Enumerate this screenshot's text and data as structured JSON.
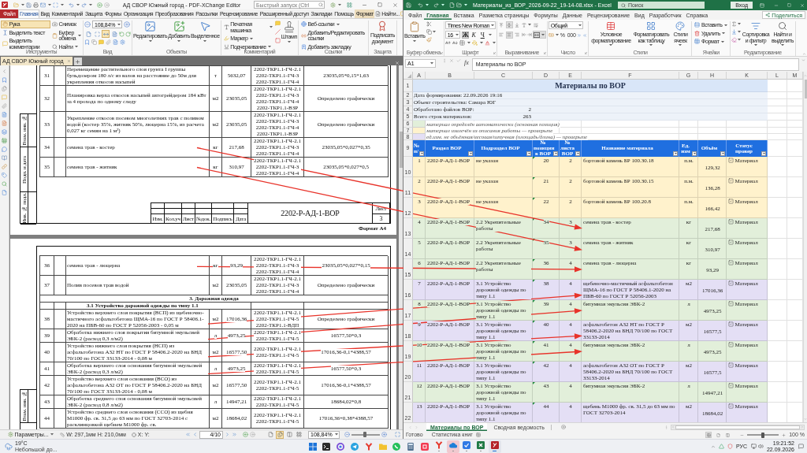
{
  "pdf": {
    "title": "АД СВОР Южный город - PDF-XChange Editor",
    "quick_launch": {
      "placeholder": "Быстрый запуск (Ctrl"
    },
    "menu_tabs": [
      {
        "label": "Файл",
        "kind": "file",
        "selected": false
      },
      {
        "label": "Главная",
        "kind": "tab",
        "selected": true
      },
      {
        "label": "Вид",
        "kind": "tab",
        "selected": false
      },
      {
        "label": "Комментарий",
        "kind": "tab",
        "selected": false
      },
      {
        "label": "Защита",
        "kind": "tab",
        "selected": false
      },
      {
        "label": "Формы",
        "kind": "tab",
        "selected": false
      },
      {
        "label": "Организация",
        "kind": "tab",
        "selected": false
      },
      {
        "label": "Преобразования",
        "kind": "tab",
        "selected": false
      },
      {
        "label": "Рассылки",
        "kind": "tab",
        "selected": false
      },
      {
        "label": "Рецензирование",
        "kind": "tab",
        "selected": false
      },
      {
        "label": "Расширенный доступ",
        "kind": "tab",
        "selected": false
      },
      {
        "label": "Закладки",
        "kind": "tab",
        "selected": false
      },
      {
        "label": "Помощь",
        "kind": "tab",
        "selected": false
      },
      {
        "label": "Формат",
        "kind": "context",
        "selected": false
      }
    ],
    "find": "Найти...",
    "ribbon": [
      {
        "kind": "tools",
        "label": "Инструменты",
        "items": [
          {
            "label": "Рука",
            "selected": true,
            "dropdown": false
          },
          {
            "label": "Выделить текст",
            "selected": false,
            "dropdown": false
          },
          {
            "label": "Выделить комментарии",
            "selected": false,
            "dropdown": false
          },
          {
            "label": "Снимок",
            "selected": false,
            "dropdown": false
          },
          {
            "label": "Буфер обмена",
            "selected": false,
            "dropdown": true
          },
          {
            "label": "Найти",
            "selected": false,
            "dropdown": true
          }
        ]
      },
      {
        "kind": "view",
        "label": "Вид",
        "zoom": "108,84%",
        "fit_modes": [
          {
            "kind": "actual",
            "selected": false
          },
          {
            "kind": "page",
            "selected": false
          },
          {
            "kind": "width",
            "selected": true
          },
          {
            "kind": "visible",
            "selected": false
          }
        ]
      },
      {
        "kind": "objects",
        "label": "Объекты",
        "items": [
          {
            "label": "Редактировать",
            "dropdown": true
          },
          {
            "label": "Добавить",
            "dropdown": true
          },
          {
            "label": "Выделенное",
            "dropdown": true
          }
        ]
      },
      {
        "kind": "comment",
        "label": "Комментарий",
        "items": [
          {
            "label": "Печатная машинка",
            "dropdown": true
          },
          {
            "label": "Маркер",
            "dropdown": true
          },
          {
            "label": "Подчеркивание",
            "dropdown": true
          },
          {
            "label": "Штамп",
            "dropdown": true
          }
        ]
      },
      {
        "kind": "links",
        "label": "Ссылки",
        "items": [
          {
            "label": "Веб-ссылки",
            "dropdown": true
          },
          {
            "label": "Добавить/Редактировать ссылки",
            "dropdown": false
          },
          {
            "label": "Добавить закладку",
            "dropdown": false
          }
        ]
      },
      {
        "kind": "protect",
        "label": "Защита",
        "items": [
          {
            "label": "Подписать документ",
            "dropdown": false
          }
        ]
      }
    ],
    "document_tab": "АД СВОР Южный город",
    "pages": [
      {
        "side_stamp": [
          "Взам. инв. №",
          "Подп. и дата",
          "Инв. № подл."
        ],
        "rows": [
          {
            "kind": "item",
            "number": "31",
            "name": "Перемещение растительного слоя грунта I группы бульдозером 180 л/с из валов на расстояние до 50м для укрепления откосов насыпей",
            "unit": "т",
            "quantity": "5632,07",
            "sheets": [
              "2202-ТКР1.1-ГЧ-2.1",
              "2202-ТКР1.1-ГЧ-3",
              "2202-ТКР1.1-ГЧ-4"
            ],
            "formula": "23035,05*0,15*1,63"
          },
          {
            "kind": "item",
            "number": "32",
            "name": "Планировка верха откосов насыпей автогрейдером 184 кВт за 4 прохода по одному следу",
            "unit": "м2",
            "quantity": "23035,05",
            "sheets": [
              "2202-ТКР1.1-ГЧ-2.1",
              "2202-ТКР1.1-ГЧ-3",
              "2202-ТКР1.1-ГЧ-4",
              "2202-ТКР1.1-ВЗР"
            ],
            "formula": "Определено графически"
          },
          {
            "kind": "item",
            "number": "33",
            "name": "Укрепление откосов посевом многолетних трав с поливом водой (костер 35%, житняк 50%, люцерна 15%, из расчета 0,027 кг семян на 1 м²)",
            "unit": "м2",
            "quantity": "23035,05",
            "sheets": [
              "2202-ТКР1.1-ГЧ-2.1",
              "2202-ТКР1.1-ГЧ-3",
              "2202-ТКР1.1-ГЧ-4",
              "2202-ТКР1.1-ВЗР"
            ],
            "formula": "Определено графически"
          },
          {
            "kind": "item",
            "number": "34",
            "name": "семена трав - костер",
            "unit": "кг",
            "quantity": "217,68",
            "sheets": [
              "2202-ТКР1.1-ГЧ-2.1",
              "2202-ТКР1.1-ГЧ-3",
              "2202-ТКР1.1-ГЧ-4"
            ],
            "formula": "23035,05*0,027*0,35"
          },
          {
            "kind": "item",
            "number": "35",
            "name": "семена трав - житняк",
            "unit": "кг",
            "quantity": "310,97",
            "sheets": [
              "2202-ТКР1.1-ГЧ-2.1",
              "2202-ТКР1.1-ГЧ-3",
              "2202-ТКР1.1-ГЧ-4"
            ],
            "formula": "23035,05*0,027*0,5"
          }
        ],
        "title_block": {
          "headers": [
            "Изм.",
            "Кол.уч",
            "Лист",
            "№док.",
            "Подпись",
            "Дата"
          ],
          "code": "2202-Р-АД-1-ВОР",
          "sheet_label": "Лист",
          "sheet": "3"
        },
        "format": "Формат А4"
      },
      {
        "side_stamp": [
          "Взам. инв. №"
        ],
        "rows": [
          {
            "kind": "item",
            "number": "36",
            "name": "семена трав - люцерна",
            "unit": "кг",
            "quantity": "93,29",
            "sheets": [
              "2202-ТКР1.1-ГЧ-2.1",
              "2202-ТКР1.1-ГЧ-3",
              "2202-ТКР1.1-ГЧ-4"
            ],
            "formula": "23035,05*0,027*0,15"
          },
          {
            "kind": "item",
            "number": "37",
            "name": "Полив посевов трав водой",
            "unit": "м2",
            "quantity": "23035,05",
            "sheets": [
              "2202-ТКР1.1-ГЧ-2.1",
              "2202-ТКР1.1-ГЧ-3",
              "2202-ТКР1.1-ГЧ-4"
            ],
            "formula": "Определено графически"
          },
          {
            "kind": "section",
            "title": "3. Дорожная одежда"
          },
          {
            "kind": "subsection",
            "title": "3.1 Устройство дорожной одежды по типу 1.1"
          },
          {
            "kind": "item",
            "number": "38",
            "name": "Устройство верхнего слоя покрытия (ВСП) из щебеночно-мастичного асфальтобетона ЩМА-16 по ГОСТ Р 58406.1-2020 на ПБВ-60 по ГОСТ Р 52056-2003 - 0,05 м",
            "unit": "м2",
            "quantity": "17016,36",
            "sheets": [
              "2202-ТКР1.1-ГЧ-2.1",
              "2202-ТКР1.1-ГЧ-5",
              "2202-ТКР1.1-ВДП"
            ],
            "formula": "Определено графически"
          },
          {
            "kind": "item",
            "number": "39",
            "name": "Обработка нижнего слоя покрытия битумной эмульсией ЭБК-2 (расход 0,3 л/м2)",
            "unit": "л",
            "quantity": "4973,25",
            "sheets": [
              "2202-ТКР1.1-ГЧ-2.1",
              "2202-ТКР1.1-ГЧ-5"
            ],
            "formula": "16577,50*0,3"
          },
          {
            "kind": "item",
            "number": "40",
            "name": "Устройство нижнего слоя покрытия (НСП) из асфальтобетона А32 НТ по ГОСТ Р 58406.2-2020 на БНД 70/100 по ГОСТ 33133-2014 - 0,08 м",
            "unit": "м2",
            "quantity": "16577,50",
            "sheets": [
              "2202-ТКР1.1-ГЧ-2.1",
              "2202-ТКР1.1-ГЧ-5"
            ],
            "formula": "17016,36-0,1*4388,57"
          },
          {
            "kind": "item",
            "number": "41",
            "name": "Обработка верхнего слоя основания битумной эмульсией ЭБК-2 (расход 0,3 л/м2)",
            "unit": "л",
            "quantity": "4973,25",
            "sheets": [
              "2202-ТКР1.1-ГЧ-2.1",
              "2202-ТКР1.1-ГЧ-5"
            ],
            "formula": "16577,50*0,3"
          },
          {
            "kind": "item",
            "number": "42",
            "name": "Устройство верхнего слоя основания (ВСО) из асфальтобетона А32 ОТ по ГОСТ Р 58406.2-2020 на БНД 70/100 по ГОСТ 33133-2014 - 0,08 м",
            "unit": "м2",
            "quantity": "16577,50",
            "sheets": [
              "2202-ТКР1.1-ГЧ-2.1",
              "2202-ТКР1.1-ГЧ-5"
            ],
            "formula": "17016,36-0,1*4388,57"
          },
          {
            "kind": "item",
            "number": "43",
            "name": "Обработка среднего слоя основания битумной эмульсией ЭБК-2 (расход 0,8 л/м2)",
            "unit": "л",
            "quantity": "14947,21",
            "sheets": [
              "2202-ТКР1.1-ГЧ-2.1",
              "2202-ТКР1.1-ГЧ-5"
            ],
            "formula": "18684,02*0,8"
          },
          {
            "kind": "item",
            "number": "44",
            "name": "Устройство среднего слоя основания (ССО) из щебня М1000 фр. св. 31,5 до 63 мм по ГОСТ 32703-2014 с расклинцовкой щебнем М1000 фр. св.",
            "unit": "м2",
            "quantity": "18684,02",
            "sheets": [
              "2202-ТКР1.1-ГЧ-2.1",
              "2202-ТКР1.1-ГЧ-5"
            ],
            "formula": "17016,36+0,38*4388,57"
          }
        ]
      }
    ],
    "status_bar": {
      "options": "Параметры...",
      "size_w": "W: 297,1мм",
      "size_h": "H: 210,0мм",
      "x": "X:",
      "y": "Y:",
      "page": "4/10",
      "view_modes": [
        {
          "kind": "single",
          "selected": false
        },
        {
          "kind": "continuous",
          "selected": true
        },
        {
          "kind": "facing",
          "selected": false
        },
        {
          "kind": "grid",
          "selected": false
        }
      ],
      "zoom": "108,84%",
      "zoom_slider": {
        "level": 0.48
      }
    }
  },
  "excel": {
    "title": "Материалы_из_ВОР_2026-09-22_19-14-08.xlsx - Excel",
    "search": {
      "placeholder": "Поиск"
    },
    "sign_in": "Вход",
    "menu_tabs": [
      {
        "label": "Файл",
        "selected": false
      },
      {
        "label": "Главная",
        "selected": true
      },
      {
        "label": "Вставка",
        "selected": false
      },
      {
        "label": "Разметка страницы",
        "selected": false
      },
      {
        "label": "Формулы",
        "selected": false
      },
      {
        "label": "Данные",
        "selected": false
      },
      {
        "label": "Рецензирование",
        "selected": false
      },
      {
        "label": "Вид",
        "selected": false
      },
      {
        "label": "Разработчик",
        "selected": false
      },
      {
        "label": "Справка",
        "selected": false
      }
    ],
    "share": "Поделиться",
    "ribbon": [
      {
        "kind": "clipboard",
        "label": "Буфер обмена",
        "paste": "Вставить"
      },
      {
        "kind": "font",
        "label": "Шрифт",
        "font": "Times New Roman",
        "size": "16",
        "styles": [
          {
            "label": "Ж",
            "selected": true
          },
          {
            "label": "К",
            "selected": false
          },
          {
            "label": "Ч",
            "selected": false
          }
        ]
      },
      {
        "kind": "alignment",
        "label": "Выравнивание",
        "toggles": [
          {
            "kind": "top",
            "selected": false
          },
          {
            "kind": "middle",
            "selected": true
          },
          {
            "kind": "bottom",
            "selected": false
          },
          {
            "kind": "left",
            "selected": false
          },
          {
            "kind": "center",
            "selected": true
          },
          {
            "kind": "right",
            "selected": false
          },
          {
            "kind": "merge",
            "selected": true
          }
        ]
      },
      {
        "kind": "number",
        "label": "Число",
        "format": "Общий",
        "symbols": [
          "%",
          "000"
        ]
      },
      {
        "kind": "styles",
        "label": "Стили",
        "items": [
          "Условное форматирование",
          "Форматировать как таблицу",
          "Стили ячеек"
        ]
      },
      {
        "kind": "cells",
        "label": "Ячейки",
        "items": [
          "Вставить",
          "Удалить",
          "Формат"
        ]
      },
      {
        "kind": "editing",
        "label": "Редактирование",
        "items": [
          "Сортировка и фильтр",
          "Найти и выделить"
        ]
      }
    ],
    "name_box": "A1",
    "function_button": "fx",
    "formula": "Материалы по ВОР",
    "sheet": {
      "columns": [
        "A",
        "B",
        "C",
        "D",
        "E",
        "F",
        "G",
        "H",
        "K",
        "L",
        "M"
      ],
      "title": {
        "number": "1",
        "text": "Материалы по ВОР"
      },
      "info": [
        {
          "number": "2",
          "label": "Дата формирования: 22.09.2026 19:16"
        },
        {
          "number": "3",
          "label": "Объект строительства: Самара ЮГ"
        },
        {
          "number": "4",
          "label": "Обработано файлов ВОР:",
          "value": "2"
        },
        {
          "number": "5",
          "label": "Всего строк материалов:",
          "value": "263"
        }
      ],
      "legend": [
        {
          "number": "6",
          "color": "#e2efda",
          "text": "материал определён автоматически (основная позиция)"
        },
        {
          "number": "7",
          "color": "#fff2cc",
          "text": "материал извлечён из описания работы — проверьте"
        },
        {
          "number": "8",
          "color": "#e4dff5",
          "text": "ед.изм. не объёмная/весовая/штучная (площадь/длина) — проверьте"
        }
      ],
      "header": {
        "number": "9",
        "cells": [
          "№ п/",
          "Раздел ВОР",
          "Подраздел ВОР",
          "№ позиции в ВОР",
          "№ листа ВОР",
          "Название материала",
          "Ед. изм",
          "Объём",
          "Статус провер"
        ]
      },
      "rows": [
        {
          "number": "10",
          "color": "#fff2cc",
          "flagged": true,
          "checked": true,
          "cells": [
            "1",
            "2202-Р-АД-1-ВОР",
            "не указан",
            "20",
            "2",
            "бортовой камень БР 100.30.18",
            "п.м.",
            "129,32",
            "Материал"
          ]
        },
        {
          "number": "11",
          "color": "#fff2cc",
          "flagged": true,
          "checked": true,
          "cells": [
            "2",
            "2202-Р-АД-1-ВОР",
            "не указан",
            "21",
            "2",
            "бортовой камень БР 100.30.15",
            "п.м.",
            "136,28",
            "Материал"
          ]
        },
        {
          "number": "12",
          "color": "#fff2cc",
          "flagged": true,
          "checked": true,
          "cells": [
            "3",
            "2202-Р-АД-1-ВОР",
            "не указан",
            "22",
            "2",
            "бортовой камень БР 100.20.8",
            "п.м.",
            "166,42",
            "Материал"
          ]
        },
        {
          "number": "13",
          "color": "#e2efda",
          "flagged": true,
          "checked": true,
          "cells": [
            "4",
            "2202-Р-АД-1-ВОР",
            "2.2 Укрепительные работы",
            "34",
            "3",
            "семена трав - костер",
            "кг",
            "217,68",
            "Материал"
          ]
        },
        {
          "number": "14",
          "color": "#e2efda",
          "flagged": true,
          "checked": true,
          "cells": [
            "5",
            "2202-Р-АД-1-ВОР",
            "2.2 Укрепительные работы",
            "35",
            "3",
            "семена трав - житняк",
            "кг",
            "310,97",
            "Материал"
          ]
        },
        {
          "number": "15",
          "color": "#e2efda",
          "flagged": true,
          "checked": true,
          "cells": [
            "6",
            "2202-Р-АД-1-ВОР",
            "2.2 Укрепительные работы",
            "36",
            "4",
            "семена трав - люцерна",
            "кг",
            "93,29",
            "Материал"
          ]
        },
        {
          "number": "16",
          "color": "#e4dff5",
          "flagged": true,
          "checked": true,
          "cells": [
            "7",
            "2202-Р-АД-1-ВОР",
            "3.1 Устройство дорожной одежды по типу 1.1",
            "38",
            "4",
            "щебеночно-мастичный асфальтобетон ЩМА-16 по ГОСТ Р 58406.1-2020 на ПБВ-60 по ГОСТ Р 52056-2003",
            "м2",
            "17016,36",
            "Материал"
          ]
        },
        {
          "number": "17",
          "color": "#e2efda",
          "flagged": true,
          "checked": true,
          "cells": [
            "8",
            "2202-Р-АД-1-ВОР",
            "3.1 Устройство дорожной одежды по типу 1.1",
            "39",
            "4",
            "битумная эмульсия ЭБК-2",
            "л",
            "4973,25",
            "Материал"
          ]
        },
        {
          "number": "18",
          "color": "#e4dff5",
          "flagged": true,
          "checked": true,
          "cells": [
            "9",
            "2202-Р-АД-1-ВОР",
            "3.1 Устройство дорожной одежды по типу 1.1",
            "40",
            "4",
            "асфальтобетон А32 НТ по ГОСТ Р 58406.2-2020 на БНД 70/100 по ГОСТ 33133-2014",
            "м2",
            "16577,5",
            "Материал"
          ]
        },
        {
          "number": "19",
          "color": "#e2efda",
          "flagged": true,
          "checked": true,
          "cells": [
            "10",
            "2202-Р-АД-1-ВОР",
            "3.1 Устройство дорожной одежды по типу 1.1",
            "41",
            "4",
            "битумная эмульсия ЭБК-2",
            "л",
            "4973,25",
            "Материал"
          ]
        },
        {
          "number": "20",
          "color": "#e4dff5",
          "flagged": true,
          "checked": true,
          "cells": [
            "11",
            "2202-Р-АД-1-ВОР",
            "3.1 Устройство дорожной одежды по типу 1.1",
            "42",
            "4",
            "асфальтобетон А32 ОТ по ГОСТ Р 58406.2-2020 на БНД 70/100 по ГОСТ 33133-2014",
            "м2",
            "16577,5",
            "Материал"
          ]
        },
        {
          "number": "21",
          "color": "#e2efda",
          "flagged": true,
          "checked": true,
          "cells": [
            "12",
            "2202-Р-АД-1-ВОР",
            "3.1 Устройство дорожной одежды по типу 1.1",
            "43",
            "4",
            "битумная эмульсия ЭБК-2",
            "л",
            "14947,21",
            "Материал"
          ]
        },
        {
          "number": "22",
          "color": "#e4dff5",
          "flagged": true,
          "checked": true,
          "cells": [
            "13",
            "2202-Р-АД-1-ВОР",
            "3.1 Устройство дорожной одежды по типу 1.1",
            "44",
            "4",
            "щебень М1000 фр. св. 31,5 до 63 мм по ГОСТ 32703-2014",
            "м2",
            "18684,02",
            "Материал"
          ]
        }
      ]
    },
    "sheet_tabs": [
      {
        "label": "Материалы по ВОР",
        "selected": true
      },
      {
        "label": "Сводная ведомость",
        "selected": false
      }
    ],
    "status_bar": {
      "ready": "Готово",
      "statistics": "Статистика книг",
      "views": [
        {
          "kind": "normal",
          "selected": true
        },
        {
          "kind": "layout",
          "selected": false
        },
        {
          "kind": "breaks",
          "selected": false
        }
      ],
      "zoom_slider": {
        "level": 0.5
      },
      "zoom": "100 %"
    }
  },
  "taskbar": {
    "weather": {
      "temperature": "19°C",
      "condition": "Небольшой до..."
    },
    "apps": [
      {
        "kind": "start",
        "running": false,
        "selected": false,
        "highlighted": false
      },
      {
        "kind": "terminal",
        "running": false,
        "selected": false,
        "highlighted": false
      },
      {
        "kind": "ring",
        "running": false,
        "selected": false,
        "highlighted": false
      },
      {
        "kind": "plane",
        "running": false,
        "selected": false,
        "highlighted": false
      },
      {
        "kind": "yshape",
        "running": false,
        "selected": false,
        "highlighted": false
      },
      {
        "kind": "folder",
        "running": false,
        "selected": false,
        "highlighted": false
      },
      {
        "kind": "phone",
        "running": false,
        "selected": false,
        "highlighted": false
      },
      {
        "kind": "calculator",
        "running": false,
        "selected": false,
        "highlighted": false
      },
      {
        "kind": "tile",
        "running": false,
        "selected": false,
        "highlighted": false
      },
      {
        "kind": "yshape",
        "running": true,
        "selected": false,
        "highlighted": false
      },
      {
        "kind": "cloud",
        "running": true,
        "selected": false,
        "highlighted": true
      },
      {
        "kind": "check",
        "running": true,
        "selected": false,
        "highlighted": false
      },
      {
        "kind": "sheet",
        "running": true,
        "selected": false,
        "highlighted": false
      },
      {
        "kind": "document",
        "running": true,
        "selected": true,
        "highlighted": false
      }
    ],
    "language": "РУС",
    "time": "19:21:52",
    "date": "22.09.2026"
  }
}
